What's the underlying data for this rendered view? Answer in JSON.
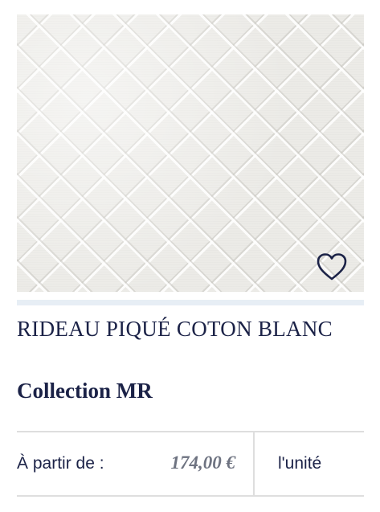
{
  "product": {
    "image_alt": "Tissu piqué coton blanc",
    "favorite_icon": "heart-outline-icon",
    "title": "RIDEAU PIQUÉ COTON BLANC",
    "collection": "Collection MR"
  },
  "pricing": {
    "label": "À partir de :",
    "value": "174,00 €",
    "unit": "l'unité"
  },
  "colors": {
    "text_primary": "#1b2247",
    "price": "#6e7381",
    "divider": "#dedede",
    "accent_bar": "#e7eef5"
  }
}
